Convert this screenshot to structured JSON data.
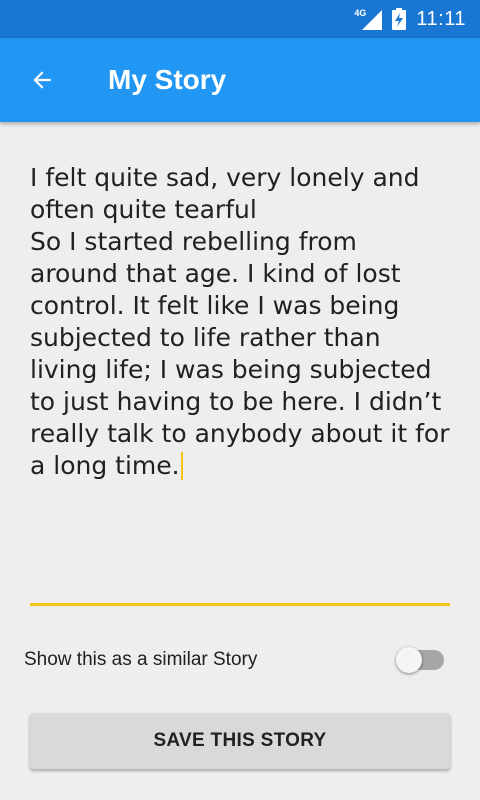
{
  "status_bar": {
    "network": "4G",
    "time": "11:11",
    "icons": [
      "signal-icon",
      "battery-charging-icon"
    ]
  },
  "app_bar": {
    "back_icon": "arrow-back-icon",
    "title": "My Story"
  },
  "story": {
    "text": "I felt quite sad, very lonely and often quite tearful\nSo I started rebelling from around that age. I kind of lost control. It felt like I was being subjected to life rather than living life; I was being subjected to just having to be here. I didn’t really talk to anybody about it for a long time."
  },
  "similar_toggle": {
    "label": "Show this as a similar Story",
    "checked": false
  },
  "save_button": {
    "label": "SAVE THIS STORY"
  },
  "colors": {
    "status_bar": "#1976d2",
    "app_bar": "#2196f3",
    "accent_underline": "#f5c518",
    "background": "#eeeeee"
  }
}
